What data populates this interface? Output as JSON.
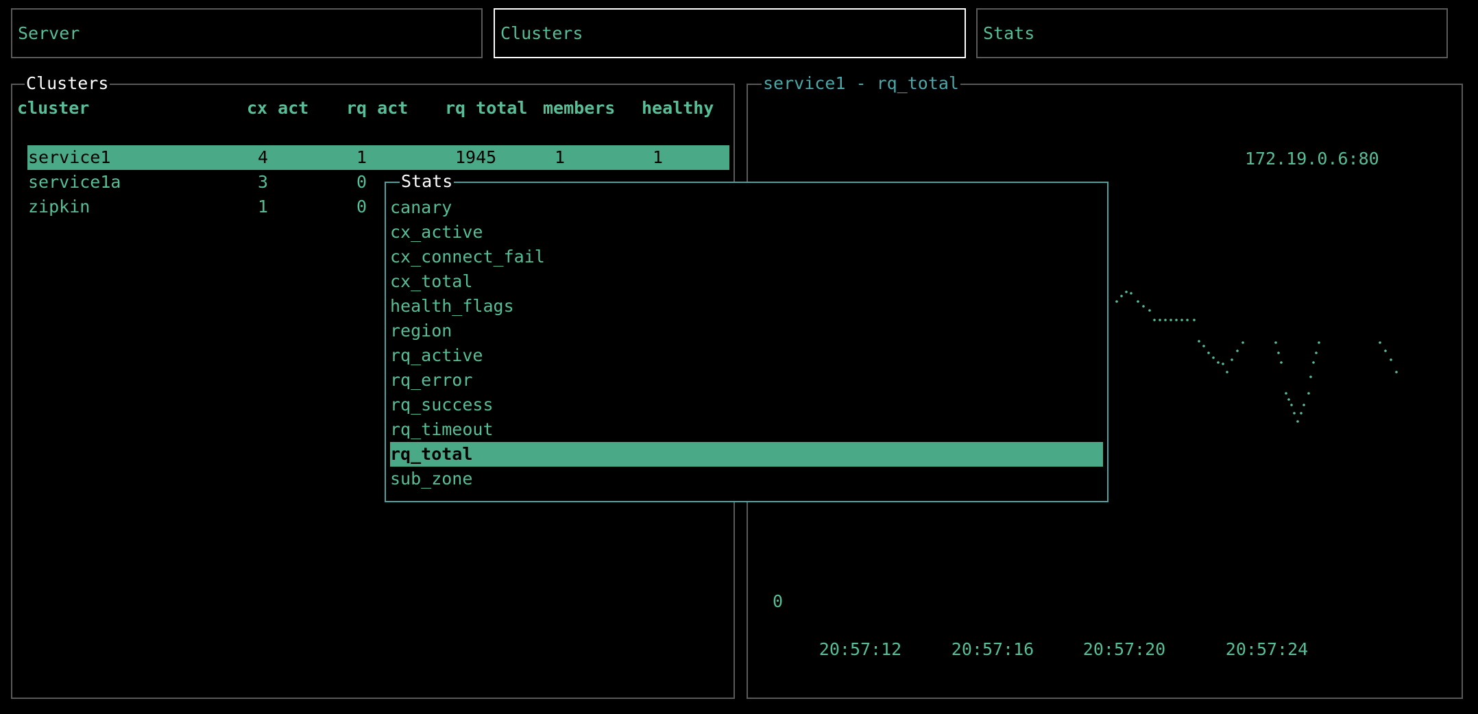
{
  "tabs": [
    {
      "label": "Server"
    },
    {
      "label": "Clusters",
      "active": true
    },
    {
      "label": "Stats"
    }
  ],
  "clusters_panel": {
    "title": "Clusters",
    "columns": [
      "cluster",
      "cx act",
      "rq act",
      "rq total",
      "members",
      "healthy"
    ],
    "rows": [
      {
        "cluster": "service1",
        "cx_act": "4",
        "rq_act": "1",
        "rq_total": "1945",
        "members": "1",
        "healthy": "1",
        "selected": true
      },
      {
        "cluster": "service1a",
        "cx_act": "3",
        "rq_act": "0"
      },
      {
        "cluster": "zipkin",
        "cx_act": "1",
        "rq_act": "0"
      }
    ]
  },
  "stats_popup": {
    "title": "Stats",
    "items": [
      "canary",
      "cx_active",
      "cx_connect_fail",
      "cx_total",
      "health_flags",
      "region",
      "rq_active",
      "rq_error",
      "rq_success",
      "rq_timeout",
      "rq_total",
      "sub_zone"
    ],
    "selected": "rq_total"
  },
  "chart_data": {
    "type": "line",
    "title": "service1 - rq_total",
    "series": [
      {
        "name": "172.19.0.6:80"
      }
    ],
    "y_tick_labels": [
      "0"
    ],
    "x_tick_labels": [
      "20:57:12",
      "20:57:16",
      "20:57:20",
      "20:57:24"
    ]
  },
  "colors": {
    "text": "#56bf98",
    "highlight": "#4aaa88",
    "popup_border": "#4aa3a3",
    "chart_title": "#4aa8a8",
    "active_tab_border": "#ffffff",
    "border": "#5a5a5a"
  }
}
